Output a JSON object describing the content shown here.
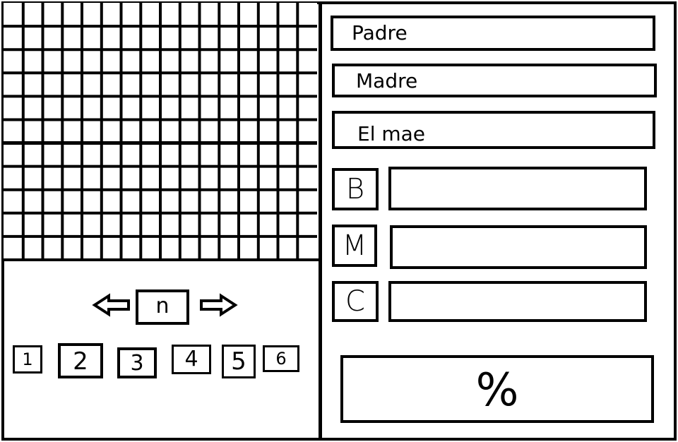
{
  "grid": {
    "columns": 16,
    "rows": 11,
    "thick_line_rows": [
      6
    ]
  },
  "pager": {
    "prev_icon": "left-arrow-icon",
    "current_label": "n",
    "next_icon": "right-arrow-icon",
    "page_numbers": [
      "1",
      "2",
      "3",
      "4",
      "5",
      "6"
    ]
  },
  "fields": {
    "father": "Padre",
    "mother": "Madre",
    "subject": "El mae"
  },
  "letters": {
    "b_label": "B",
    "m_label": "M",
    "c_label": "C",
    "b_value": "",
    "m_value": "",
    "c_value": ""
  },
  "percentage": {
    "label": "%"
  },
  "colors": {
    "line": "#000000",
    "background": "#ffffff"
  }
}
